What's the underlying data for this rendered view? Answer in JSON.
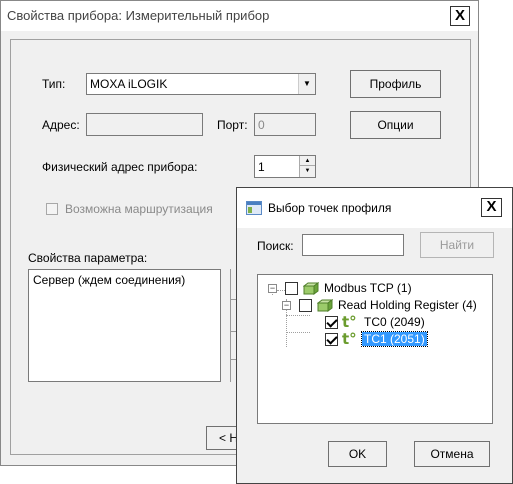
{
  "main_dialog": {
    "title": "Свойства прибора: Измерительный прибор",
    "close": "X",
    "type_label": "Тип:",
    "type_value": "MOXA iLOGIK",
    "profile_button": "Профиль",
    "address_label": "Адрес:",
    "address_value": "",
    "port_label": "Порт:",
    "port_value": "0",
    "options_button": "Опции",
    "phys_address_label": "Физический адрес прибора:",
    "phys_address_value": "1",
    "routing_label": "Возможна маршрутизация",
    "param_props_label": "Свойства параметра:",
    "param_props_text": "Сервер (ждем соединения)",
    "back_button_partial": "< Н"
  },
  "profile_dialog": {
    "title": "Выбор точек профиля",
    "close": "X",
    "search_label": "Поиск:",
    "search_value": "",
    "find_button": "Найти",
    "tree": [
      {
        "label": "Modbus TCP (1)",
        "level": 0,
        "checked": false,
        "expanded": true,
        "icon": "cube-icon"
      },
      {
        "label": "Read Holding Register (4)",
        "level": 1,
        "checked": false,
        "expanded": true,
        "icon": "cube-icon"
      },
      {
        "label": "TC0 (2049)",
        "level": 2,
        "checked": true,
        "icon": "temperature-icon"
      },
      {
        "label": "TC1 (2051)",
        "level": 2,
        "checked": true,
        "icon": "temperature-icon",
        "selected": true
      }
    ],
    "temp_icon_text": "t°",
    "ok_button": "OK",
    "cancel_button": "Отмена"
  }
}
